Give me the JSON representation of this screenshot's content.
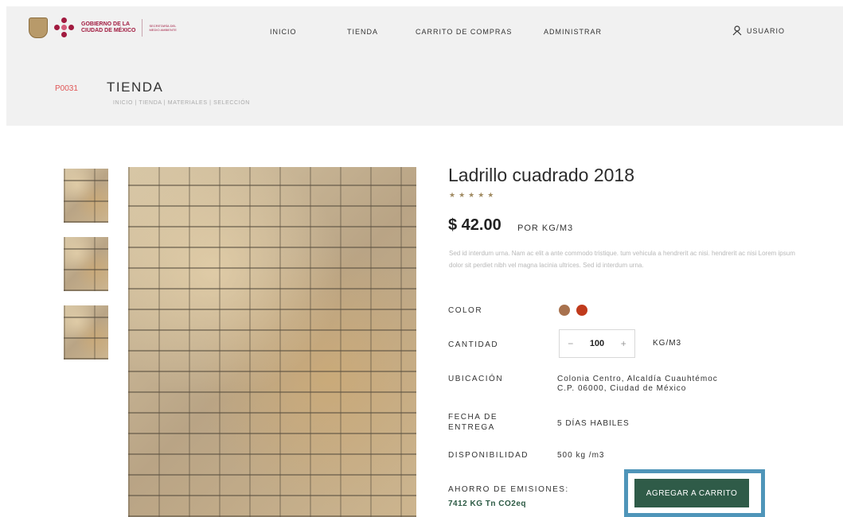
{
  "header": {
    "gov_line1": "GOBIERNO DE LA",
    "gov_line2": "CIUDAD DE MÉXICO",
    "secretaria_line1": "SECRETARÍA DEL",
    "secretaria_line2": "MEDIO AMBIENTE",
    "nav": [
      "INICIO",
      "TIENDA",
      "CARRITO DE COMPRAS",
      "ADMINISTRAR"
    ],
    "user_label": "USUARIO"
  },
  "page": {
    "code": "P0031",
    "title": "TIENDA",
    "breadcrumb": "INICIO | TIENDA | MATERIALES | SELECCIÓN"
  },
  "product": {
    "name": "Ladrillo cuadrado 2018",
    "rating_stars": 5,
    "stars_text": "★★★★★",
    "price": "$ 42.00",
    "price_unit": "POR KG/M3",
    "description": "Sed id interdum urna. Nam ac elit a ante commodo tristique. tum vehicula a hendrerit ac nisi. hendrerit ac nisi Lorem ipsum dolor sit perdiet nibh vel magna lacinia ultrices. Sed id interdum urna.",
    "color_label": "COLOR",
    "colors": [
      "#a8724e",
      "#c03a1c"
    ],
    "quantity_label": "CANTIDAD",
    "quantity": "100",
    "minus": "−",
    "plus": "+",
    "quantity_unit": "KG/M3",
    "location_label": "UBICACIÓN",
    "location_line1": "Colonia Centro, Alcaldía Cuauhtémoc",
    "location_line2": "C.P. 06000, Ciudad de México",
    "delivery_label_1": "FECHA DE",
    "delivery_label_2": "ENTREGA",
    "delivery_value": "5 DÍAS HABILES",
    "availability_label": "DISPONIBILIDAD",
    "availability_value": "500 kg /m3",
    "savings_label": "AHORRO DE EMISIONES:",
    "savings_value": "7412 KG Tn CO2eq",
    "cta_label": "AGREGAR A CARRITO"
  },
  "colors": {
    "accent_red": "#a11a3f",
    "cta_green": "#2f5b48",
    "highlight_blue": "#4f95b9"
  }
}
